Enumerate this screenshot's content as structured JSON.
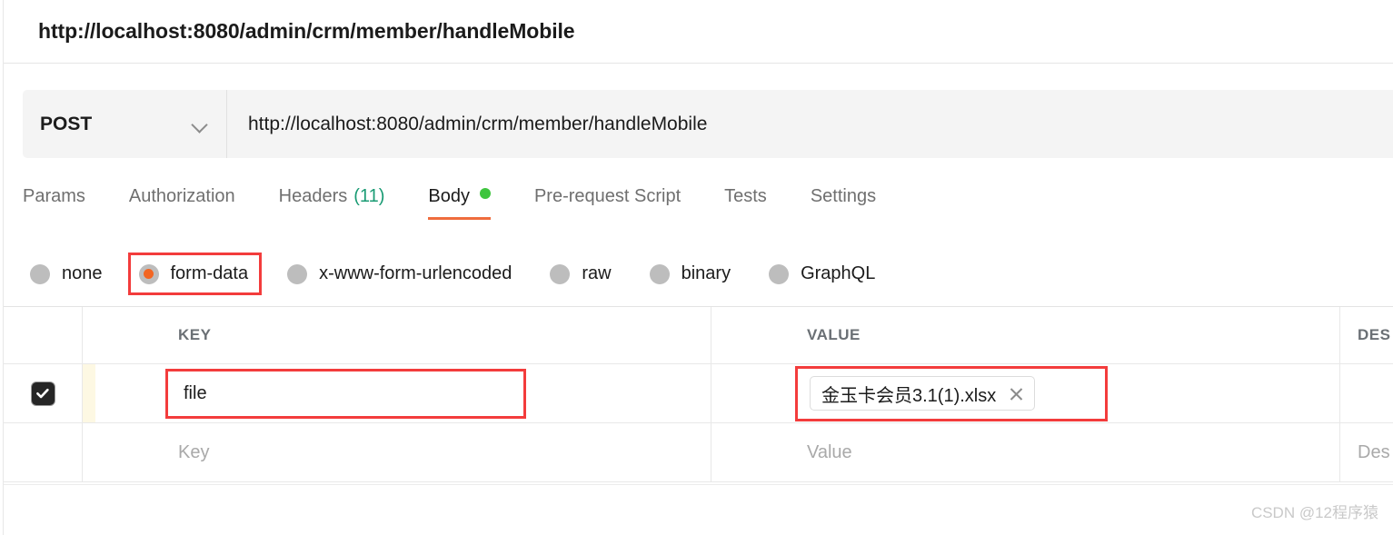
{
  "page": {
    "heading_url": "http://localhost:8080/admin/crm/member/handleMobile",
    "watermark": "CSDN @12程序猿"
  },
  "request_bar": {
    "method": "POST",
    "method_chevron_icon": "chevron-down-icon",
    "url": "http://localhost:8080/admin/crm/member/handleMobile"
  },
  "tabs": [
    {
      "label": "Params",
      "active": false,
      "count": "",
      "dot": false
    },
    {
      "label": "Authorization",
      "active": false,
      "count": "",
      "dot": false
    },
    {
      "label": "Headers",
      "active": false,
      "count": "(11)",
      "dot": false
    },
    {
      "label": "Body",
      "active": true,
      "count": "",
      "dot": true
    },
    {
      "label": "Pre-request Script",
      "active": false,
      "count": "",
      "dot": false
    },
    {
      "label": "Tests",
      "active": false,
      "count": "",
      "dot": false
    },
    {
      "label": "Settings",
      "active": false,
      "count": "",
      "dot": false
    }
  ],
  "body_types": [
    {
      "label": "none",
      "selected": false,
      "highlighted": false
    },
    {
      "label": "form-data",
      "selected": true,
      "highlighted": true
    },
    {
      "label": "x-www-form-urlencoded",
      "selected": false,
      "highlighted": false
    },
    {
      "label": "raw",
      "selected": false,
      "highlighted": false
    },
    {
      "label": "binary",
      "selected": false,
      "highlighted": false
    },
    {
      "label": "GraphQL",
      "selected": false,
      "highlighted": false
    }
  ],
  "table": {
    "headers": {
      "key": "KEY",
      "value": "VALUE",
      "description": "DES"
    },
    "rows": [
      {
        "checked": true,
        "key": "file",
        "value_file_name": "金玉卡会员3.1(1).xlsx",
        "value_remove_icon": "close-icon",
        "description": ""
      }
    ],
    "placeholder_row": {
      "key": "Key",
      "value": "Value",
      "description": "Des"
    }
  },
  "colors": {
    "accent_orange": "#ef6c3d",
    "radio_selected": "#f26522",
    "annotation_red": "#f33c3c",
    "body_dot_green": "#3fc53f",
    "count_teal": "#1a9b74"
  }
}
